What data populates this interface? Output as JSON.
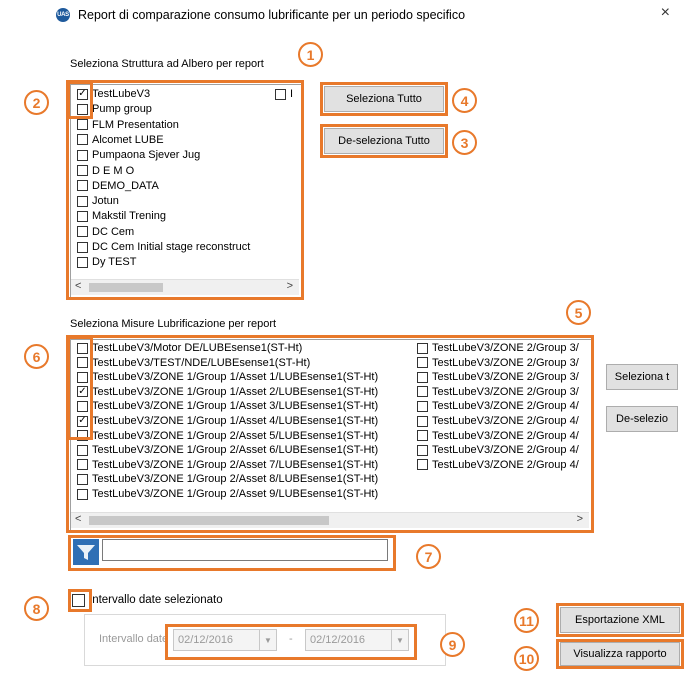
{
  "window": {
    "icon_text": "UAS",
    "title": "Report di comparazione consumo lubrificante per un periodo specifico",
    "close_symbol": "×"
  },
  "tree_section": {
    "label": "Seleziona Struttura ad Albero per report",
    "items": [
      {
        "label": "TestLubeV3",
        "checked": true
      },
      {
        "label": "Pump group",
        "checked": false
      },
      {
        "label": "FLM Presentation",
        "checked": false
      },
      {
        "label": "Alcomet LUBE",
        "checked": false
      },
      {
        "label": "Pumpaona Sjever Jug",
        "checked": false
      },
      {
        "label": "D E M O",
        "checked": false
      },
      {
        "label": "DEMO_DATA",
        "checked": false
      },
      {
        "label": "Jotun",
        "checked": false
      },
      {
        "label": "Makstil Trening",
        "checked": false
      },
      {
        "label": "DC Cem",
        "checked": false
      },
      {
        "label": "DC Cem Initial stage reconstruct",
        "checked": false
      },
      {
        "label": "Dy TEST",
        "checked": false
      }
    ],
    "second_column_items": [
      {
        "label": "I",
        "checked": false
      }
    ],
    "select_all_label": "Seleziona Tutto",
    "deselect_all_label": "De-seleziona Tutto"
  },
  "measures_section": {
    "label": "Seleziona Misure Lubrificazione per report",
    "column1": [
      {
        "label": "TestLubeV3/Motor DE/LUBEsense1(ST-Ht)",
        "checked": false
      },
      {
        "label": "TestLubeV3/TEST/NDE/LUBEsense1(ST-Ht)",
        "checked": false
      },
      {
        "label": "TestLubeV3/ZONE 1/Group 1/Asset 1/LUBEsense1(ST-Ht)",
        "checked": false
      },
      {
        "label": "TestLubeV3/ZONE 1/Group 1/Asset 2/LUBEsense1(ST-Ht)",
        "checked": true
      },
      {
        "label": "TestLubeV3/ZONE 1/Group 1/Asset 3/LUBEsense1(ST-Ht)",
        "checked": false
      },
      {
        "label": "TestLubeV3/ZONE 1/Group 1/Asset 4/LUBEsense1(ST-Ht)",
        "checked": true
      },
      {
        "label": "TestLubeV3/ZONE 1/Group 2/Asset 5/LUBEsense1(ST-Ht)",
        "checked": false
      },
      {
        "label": "TestLubeV3/ZONE 1/Group 2/Asset 6/LUBEsense1(ST-Ht)",
        "checked": false
      },
      {
        "label": "TestLubeV3/ZONE 1/Group 2/Asset 7/LUBEsense1(ST-Ht)",
        "checked": false
      },
      {
        "label": "TestLubeV3/ZONE 1/Group 2/Asset 8/LUBEsense1(ST-Ht)",
        "checked": false
      },
      {
        "label": "TestLubeV3/ZONE 1/Group 2/Asset 9/LUBEsense1(ST-Ht)",
        "checked": false
      }
    ],
    "column2": [
      {
        "label": "TestLubeV3/ZONE 2/Group 3/",
        "checked": false
      },
      {
        "label": "TestLubeV3/ZONE 2/Group 3/",
        "checked": false
      },
      {
        "label": "TestLubeV3/ZONE 2/Group 3/",
        "checked": false
      },
      {
        "label": "TestLubeV3/ZONE 2/Group 3/",
        "checked": false
      },
      {
        "label": "TestLubeV3/ZONE 2/Group 4/",
        "checked": false
      },
      {
        "label": "TestLubeV3/ZONE 2/Group 4/",
        "checked": false
      },
      {
        "label": "TestLubeV3/ZONE 2/Group 4/",
        "checked": false
      },
      {
        "label": "TestLubeV3/ZONE 2/Group 4/",
        "checked": false
      },
      {
        "label": "TestLubeV3/ZONE 2/Group 4/",
        "checked": false
      }
    ],
    "select_all_label": "Seleziona t",
    "deselect_all_label": "De-selezio"
  },
  "filter": {
    "value": "",
    "placeholder": ""
  },
  "date_range": {
    "checkbox_label": "Intervallo date selezionato",
    "checked": false,
    "range_label": "Intervallo date",
    "from": "02/12/2016",
    "separator": "-",
    "to": "02/12/2016"
  },
  "actions": {
    "export_xml_label": "Esportazione XML",
    "view_report_label": "Visualizza rapporto"
  },
  "annotations": {
    "color": "#e8792b",
    "numbers": [
      "1",
      "2",
      "3",
      "4",
      "5",
      "6",
      "7",
      "8",
      "9",
      "10",
      "11"
    ]
  },
  "scroll_arrows": {
    "left": "<",
    "right": ">"
  }
}
